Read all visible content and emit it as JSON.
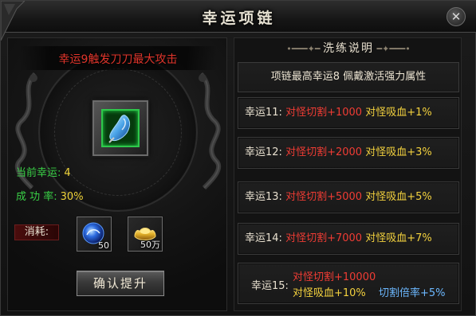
{
  "window": {
    "title": "幸运项链",
    "close_glyph": "✕"
  },
  "left": {
    "banner": "幸运9触发刀刀最大攻击",
    "item_icon": "gem-icon",
    "current_luck_label": "当前幸运:",
    "current_luck_value": "4",
    "success_rate_label": "成 功 率:",
    "success_rate_value": "30%",
    "cost_label": "消耗:",
    "costs": [
      {
        "icon": "blue-orb-icon",
        "count": "50"
      },
      {
        "icon": "gold-ingot-icon",
        "count": "50万"
      }
    ],
    "confirm_button": "确认提升"
  },
  "right": {
    "header": "洗练说明",
    "description": "项链最高幸运8 佩戴激活强力属性",
    "rows": [
      {
        "label": "幸运11:",
        "a": "对怪切割+1000",
        "b": "对怪吸血+1%"
      },
      {
        "label": "幸运12:",
        "a": "对怪切割+2000",
        "b": "对怪吸血+3%"
      },
      {
        "label": "幸运13:",
        "a": "对怪切割+5000",
        "b": "对怪吸血+5%"
      },
      {
        "label": "幸运14:",
        "a": "对怪切割+7000",
        "b": "对怪吸血+7%"
      }
    ],
    "last_row": {
      "label": "幸运15:",
      "a": "对怪切割+10000",
      "b": "对怪吸血+10%",
      "c": "切割倍率+5%"
    }
  },
  "colors": {
    "red": "#f03c34",
    "yellow": "#f4d23e",
    "green": "#39d046",
    "blue": "#6cb8ff"
  }
}
